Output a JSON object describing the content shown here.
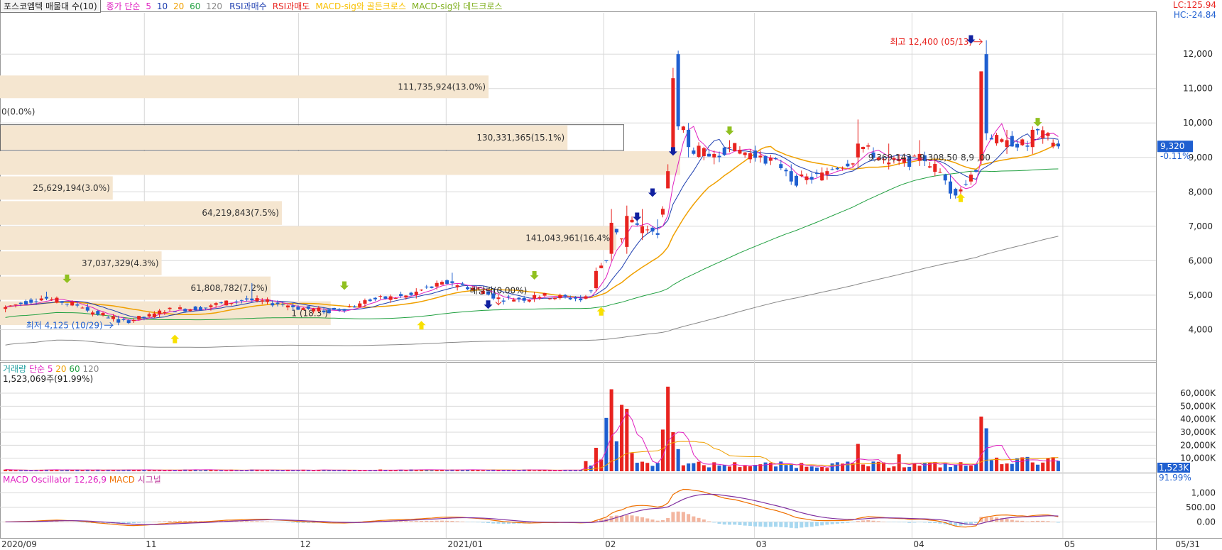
{
  "colors": {
    "up": "#e8231f",
    "down": "#1f5fd0",
    "ma5": "#e020c0",
    "ma10": "#1f3fb0",
    "ma20": "#f0a000",
    "ma60": "#20a040",
    "ma120": "#888888",
    "profile": "#f5e6d0",
    "grid": "#d8d8d8",
    "osc_pos": "#f3b6a0",
    "osc_neg": "#a8d8f0",
    "macd": "#f07000",
    "signal": "#8030a0",
    "arrow_green": "#90c020",
    "arrow_yellow": "#f8e000",
    "arrow_blue": "#1020a0",
    "arrow_red": "#e02020"
  },
  "legend_top": {
    "title": "포스코엠텍 매물대 수(10)",
    "ma_prefix": "종가 단순",
    "ma_periods": [
      "5",
      "10",
      "20",
      "60",
      "120"
    ],
    "rsi_buy": "RSI과매수",
    "rsi_sell": "RSI과매도",
    "golden": "MACD-sig와 골든크로스",
    "dead": "MACD-sig와 데드크로스"
  },
  "corner": {
    "lc": "LC:125.94",
    "hc": "HC:-24.84"
  },
  "price_panel": {
    "current_price": "9,320",
    "change_pct": "-0.11%",
    "high_label": "최고 12,400 (05/13)",
    "low_label": "최저 4,125 (10/29)",
    "dividend_label": "배당락(0.00%)",
    "avg_labels": [
      "9,369,143",
      "9,308,50",
      "8,9 ,00"
    ]
  },
  "volume_legend": {
    "title": "거래량",
    "ma_prefix": "단순",
    "periods": [
      "5",
      "20",
      "60",
      "120"
    ],
    "current": "1,523,069주(91.99%)",
    "badge_value": "1,523K",
    "badge_pct": "91.99%"
  },
  "macd_legend": {
    "oscillator": "MACD Oscillator 12,26,9",
    "macd": "MACD",
    "signal": "시그널"
  },
  "x_axis": {
    "labels": [
      "2020/09",
      "11",
      "12",
      "2021/01",
      "02",
      "03",
      "04",
      "05",
      "05/31"
    ]
  },
  "chart_data": [
    {
      "type": "candlestick",
      "title": "포스코엠텍",
      "y_axis_ticks": [
        4000,
        5000,
        6000,
        7000,
        8000,
        9000,
        10000,
        11000,
        12000
      ],
      "y_axis_labels": [
        "4,000",
        "5,000",
        "6,000",
        "7,000",
        "8,000",
        "9,000",
        "10,000",
        "11,000",
        "12,000"
      ],
      "ylim": [
        3100,
        13200
      ],
      "volume_profile": [
        {
          "price_low": 10700,
          "price_high": 11400,
          "label": "111,735,924(13.0%)",
          "pct": 13.0
        },
        {
          "price_low": 9950,
          "price_high": 10700,
          "label": "0(0.0%)",
          "pct": 0.0
        },
        {
          "price_low": 9200,
          "price_high": 9950,
          "label": "130,331,365(15.1%)",
          "pct": 15.1
        },
        {
          "price_low": 8470,
          "price_high": 9200,
          "label": "",
          "pct": 18.1
        },
        {
          "price_low": 7750,
          "price_high": 8470,
          "label": "25,629,194(3.0%)",
          "pct": 3.0
        },
        {
          "price_low": 7020,
          "price_high": 7750,
          "label": "64,219,843(7.5%)",
          "pct": 7.5
        },
        {
          "price_low": 6290,
          "price_high": 7020,
          "label": "141,043,961(16.4%)",
          "pct": 16.4
        },
        {
          "price_low": 5560,
          "price_high": 6290,
          "label": "37,037,329(4.3%)",
          "pct": 4.3
        },
        {
          "price_low": 4840,
          "price_high": 5560,
          "label": "61,808,782(7.2%)",
          "pct": 7.2
        },
        {
          "price_low": 4110,
          "price_high": 4840,
          "label": "1 (18.3 )",
          "pct": 8.8
        }
      ],
      "keypoints": [
        {
          "i": 0,
          "o": 4600,
          "h": 4700,
          "l": 4500,
          "c": 4650
        },
        {
          "i": 8,
          "o": 4950,
          "h": 5100,
          "l": 4850,
          "c": 4900
        },
        {
          "i": 16,
          "o": 4650,
          "h": 4750,
          "l": 4500,
          "c": 4550
        },
        {
          "i": 22,
          "o": 4300,
          "h": 4400,
          "l": 4125,
          "c": 4200
        },
        {
          "i": 30,
          "o": 4450,
          "h": 4600,
          "l": 4350,
          "c": 4550
        },
        {
          "i": 40,
          "o": 4650,
          "h": 4750,
          "l": 4550,
          "c": 4700
        },
        {
          "i": 48,
          "o": 4900,
          "h": 5350,
          "l": 4800,
          "c": 4850
        },
        {
          "i": 56,
          "o": 4700,
          "h": 4800,
          "l": 4550,
          "c": 4650
        },
        {
          "i": 62,
          "o": 4550,
          "h": 4650,
          "l": 4450,
          "c": 4500
        },
        {
          "i": 70,
          "o": 4750,
          "h": 4900,
          "l": 4650,
          "c": 4850
        },
        {
          "i": 80,
          "o": 5000,
          "h": 5200,
          "l": 4900,
          "c": 5100
        },
        {
          "i": 87,
          "o": 5400,
          "h": 5650,
          "l": 5250,
          "c": 5350
        },
        {
          "i": 95,
          "o": 5050,
          "h": 5200,
          "l": 4850,
          "c": 4900
        },
        {
          "i": 103,
          "o": 4900,
          "h": 5100,
          "l": 4800,
          "c": 5000
        },
        {
          "i": 112,
          "o": 4900,
          "h": 5000,
          "l": 4800,
          "c": 4850
        },
        {
          "i": 115,
          "o": 5200,
          "h": 5800,
          "l": 5100,
          "c": 5700
        },
        {
          "i": 118,
          "o": 6200,
          "h": 7500,
          "l": 6000,
          "c": 7100
        },
        {
          "i": 121,
          "o": 6400,
          "h": 7600,
          "l": 6200,
          "c": 7300
        },
        {
          "i": 124,
          "o": 6800,
          "h": 7500,
          "l": 6600,
          "c": 7000
        },
        {
          "i": 127,
          "o": 6800,
          "h": 7200,
          "l": 6650,
          "c": 6750
        },
        {
          "i": 129,
          "o": 8100,
          "h": 8800,
          "l": 8100,
          "c": 8600
        },
        {
          "i": 130,
          "o": 9200,
          "h": 11600,
          "l": 9100,
          "c": 11300
        },
        {
          "i": 131,
          "o": 12000,
          "h": 12100,
          "l": 9800,
          "c": 9900
        },
        {
          "i": 133,
          "o": 9800,
          "h": 10000,
          "l": 9000,
          "c": 9300
        },
        {
          "i": 138,
          "o": 9000,
          "h": 9200,
          "l": 8800,
          "c": 9100
        },
        {
          "i": 141,
          "o": 9300,
          "h": 9500,
          "l": 9150,
          "c": 9300
        },
        {
          "i": 147,
          "o": 9000,
          "h": 9200,
          "l": 8850,
          "c": 9050
        },
        {
          "i": 153,
          "o": 8600,
          "h": 8800,
          "l": 8200,
          "c": 8300
        },
        {
          "i": 160,
          "o": 8500,
          "h": 8700,
          "l": 8350,
          "c": 8600
        },
        {
          "i": 166,
          "o": 9000,
          "h": 10100,
          "l": 8700,
          "c": 9400
        },
        {
          "i": 172,
          "o": 8800,
          "h": 9400,
          "l": 8650,
          "c": 8850
        },
        {
          "i": 178,
          "o": 8900,
          "h": 9500,
          "l": 8750,
          "c": 9100
        },
        {
          "i": 184,
          "o": 8300,
          "h": 8500,
          "l": 7800,
          "c": 7950
        },
        {
          "i": 188,
          "o": 8300,
          "h": 8600,
          "l": 8200,
          "c": 8500
        },
        {
          "i": 190,
          "o": 8900,
          "h": 9500,
          "l": 8800,
          "c": 11500
        },
        {
          "i": 191,
          "o": 12000,
          "h": 12400,
          "l": 9500,
          "c": 9700
        },
        {
          "i": 195,
          "o": 9300,
          "h": 9800,
          "l": 9100,
          "c": 9500
        },
        {
          "i": 200,
          "o": 9300,
          "h": 9900,
          "l": 9100,
          "c": 9800
        },
        {
          "i": 205,
          "o": 9400,
          "h": 9500,
          "l": 9250,
          "c": 9320
        }
      ]
    },
    {
      "type": "bar",
      "title": "거래량",
      "unit": "K",
      "y_axis_ticks": [
        10000,
        20000,
        30000,
        40000,
        50000,
        60000
      ],
      "y_axis_labels": [
        "10,000K",
        "20,000K",
        "30,000K",
        "40,000K",
        "50,000K",
        "60,000K"
      ],
      "ylim": [
        0,
        72000
      ],
      "spikes": [
        {
          "i": 115,
          "value": 18000
        },
        {
          "i": 116,
          "value": 9000
        },
        {
          "i": 117,
          "value": 41000
        },
        {
          "i": 118,
          "value": 63000
        },
        {
          "i": 119,
          "value": 23000
        },
        {
          "i": 120,
          "value": 51000
        },
        {
          "i": 121,
          "value": 48000
        },
        {
          "i": 122,
          "value": 14000
        },
        {
          "i": 128,
          "value": 32000
        },
        {
          "i": 129,
          "value": 65000
        },
        {
          "i": 130,
          "value": 30000
        },
        {
          "i": 131,
          "value": 17000
        },
        {
          "i": 166,
          "value": 21000
        },
        {
          "i": 174,
          "value": 13000
        },
        {
          "i": 190,
          "value": 42000
        },
        {
          "i": 191,
          "value": 33000
        },
        {
          "i": 199,
          "value": 11000
        }
      ]
    },
    {
      "type": "line",
      "title": "MACD Oscillator 12,26,9",
      "y_axis_ticks": [
        0,
        500,
        1000
      ],
      "y_axis_labels": [
        "0.00",
        "500.00",
        "1,000"
      ],
      "ylim": [
        -500,
        1300
      ]
    }
  ]
}
